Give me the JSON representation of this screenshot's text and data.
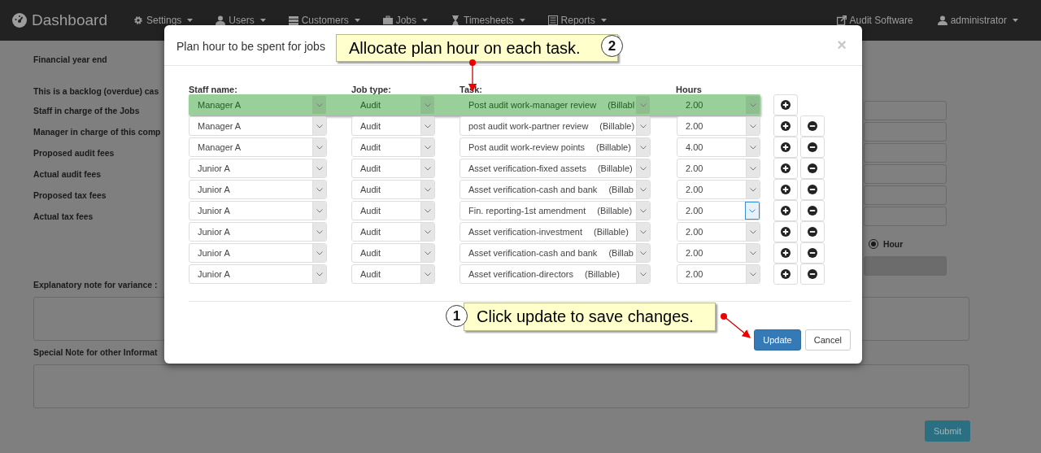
{
  "navbar": {
    "brand": "Dashboard",
    "menus": [
      "Settings",
      "Users",
      "Customers",
      "Jobs",
      "Timesheets",
      "Reports"
    ],
    "right": [
      "Audit Software",
      "administrator"
    ]
  },
  "form": {
    "top_labels": [
      "Financial year end",
      "This is a backlog (overdue) cas"
    ],
    "field_rows": [
      "Staff in charge of the Jobs",
      "Manager in charge of this comp",
      "Proposed audit fees",
      "Actual audit fees",
      "Proposed tax fees",
      "Actual tax fees"
    ],
    "radio": {
      "label": "Hour",
      "selected": true
    },
    "notes": [
      "Explanatory note for variance :",
      "Special Note for other Informat"
    ],
    "submit": "Submit"
  },
  "modal": {
    "title": "Plan hour to be spent for jobs",
    "close": "×",
    "columns": [
      "Staff name:",
      "Job type:",
      "Task:",
      "Hours"
    ],
    "rows": [
      {
        "staff": "Manager A",
        "job_type": "Audit",
        "task": "Post audit work-manager review",
        "billing": "(Billabl",
        "hours": "2.00",
        "highlighted": true,
        "removable": false,
        "focused": false
      },
      {
        "staff": "Manager A",
        "job_type": "Audit",
        "task": "post audit work-partner review",
        "billing": "(Billable)",
        "hours": "2.00",
        "highlighted": false,
        "removable": true,
        "focused": false
      },
      {
        "staff": "Manager A",
        "job_type": "Audit",
        "task": "Post audit work-review points",
        "billing": "(Billable)",
        "hours": "4.00",
        "highlighted": false,
        "removable": true,
        "focused": false
      },
      {
        "staff": "Junior A",
        "job_type": "Audit",
        "task": "Asset verification-fixed assets",
        "billing": "(Billable)",
        "hours": "2.00",
        "highlighted": false,
        "removable": true,
        "focused": false
      },
      {
        "staff": "Junior A",
        "job_type": "Audit",
        "task": "Asset verification-cash and bank",
        "billing": "(Billab",
        "hours": "2.00",
        "highlighted": false,
        "removable": true,
        "focused": false
      },
      {
        "staff": "Junior A",
        "job_type": "Audit",
        "task": "Fin. reporting-1st amendment",
        "billing": "(Billable)",
        "hours": "2.00",
        "highlighted": false,
        "removable": true,
        "focused": true
      },
      {
        "staff": "Junior A",
        "job_type": "Audit",
        "task": "Asset verification-investment",
        "billing": "(Billable)",
        "hours": "2.00",
        "highlighted": false,
        "removable": true,
        "focused": false
      },
      {
        "staff": "Junior A",
        "job_type": "Audit",
        "task": "Asset verification-cash and bank",
        "billing": "(Billab",
        "hours": "2.00",
        "highlighted": false,
        "removable": true,
        "focused": false
      },
      {
        "staff": "Junior A",
        "job_type": "Audit",
        "task": "Asset verification-directors",
        "billing": "(Billable)",
        "hours": "2.00",
        "highlighted": false,
        "removable": true,
        "focused": false
      }
    ],
    "buttons": [
      {
        "label": "Update",
        "kind": "primary"
      },
      {
        "label": "Cancel",
        "kind": "default"
      }
    ]
  },
  "callouts": [
    {
      "number": "2",
      "text": "Allocate plan hour on each task."
    },
    {
      "number": "1",
      "text": "Click update to save changes."
    }
  ]
}
